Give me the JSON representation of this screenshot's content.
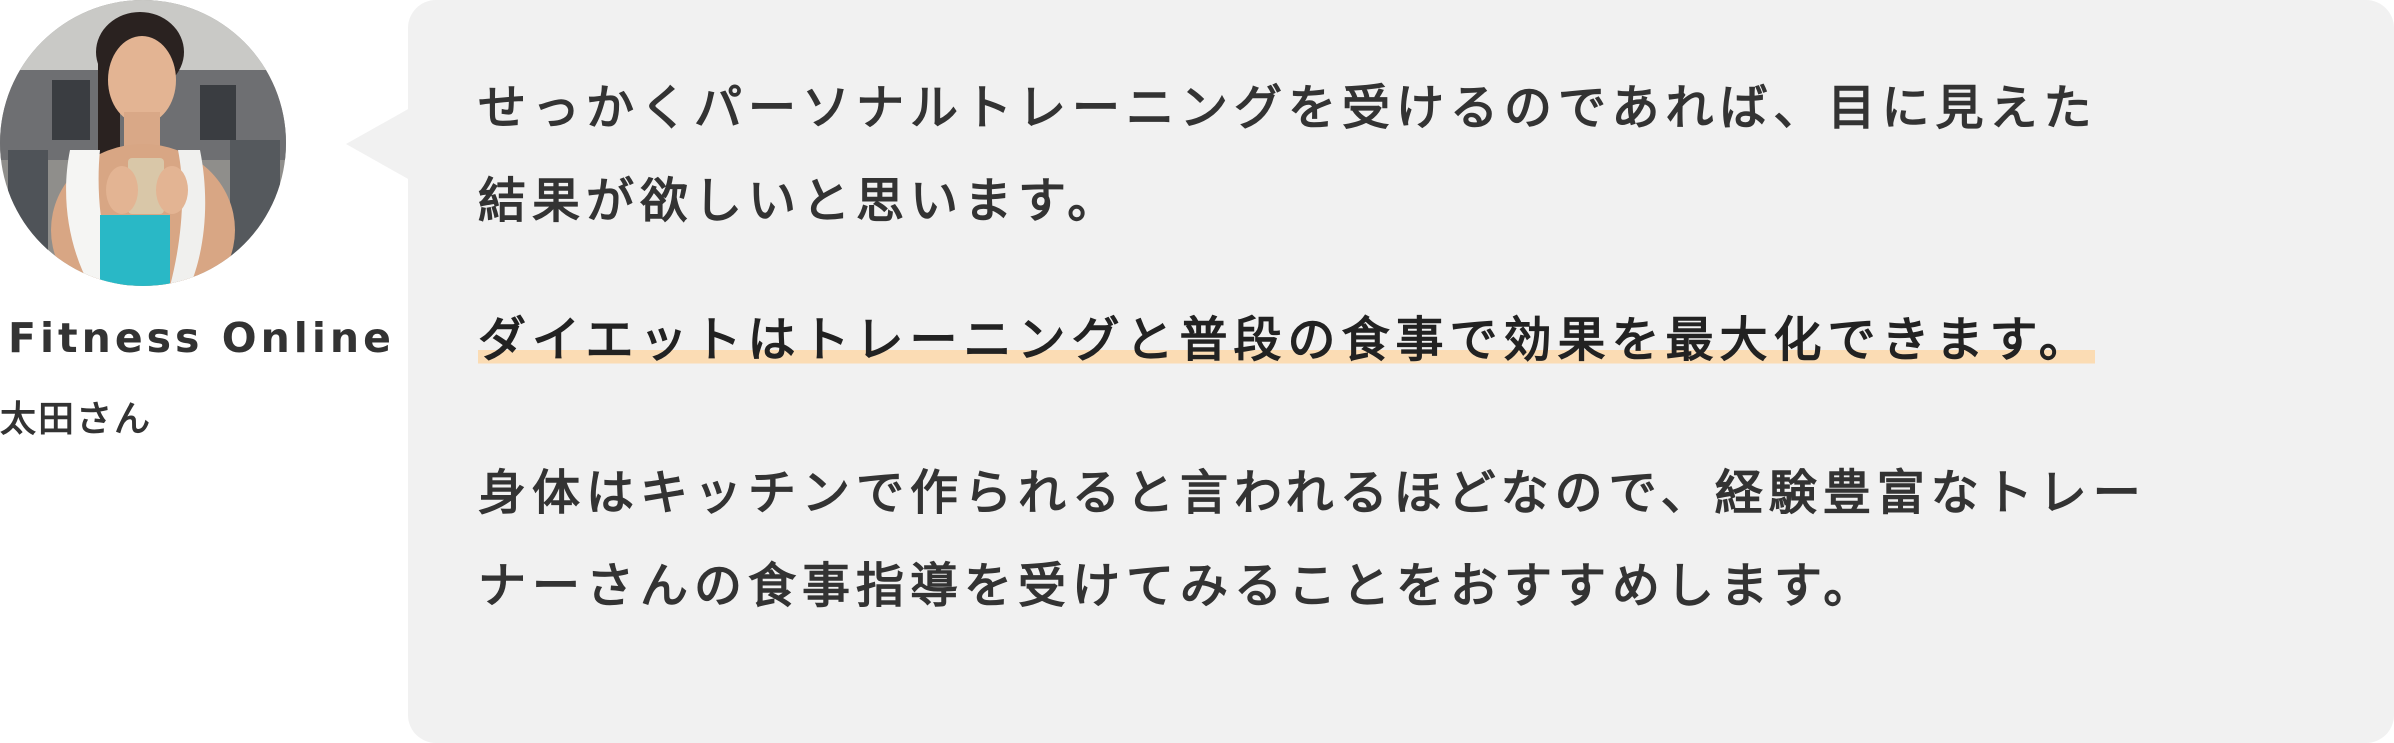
{
  "profile": {
    "avatar_alt": "太田さん",
    "site_name": "Fitness Online",
    "author_name": "太田さん"
  },
  "comment": {
    "paragraph1_line1": "せっかくパーソナルトレーニングを受けるのであれば、目に見えた",
    "paragraph1_line2": "結果が欲しいと思います。",
    "highlight": "ダイエットはトレーニングと普段の食事で効果を最大化できます。",
    "paragraph3_line1": "身体はキッチンで作られると言われるほどなので、経験豊富なトレー",
    "paragraph3_line2": "ナーさんの食事指導を受けてみることをおすすめします。"
  },
  "colors": {
    "bubble_background": "#f1f1f1",
    "highlight_marker": "#fbdcb4",
    "text": "#333333"
  }
}
